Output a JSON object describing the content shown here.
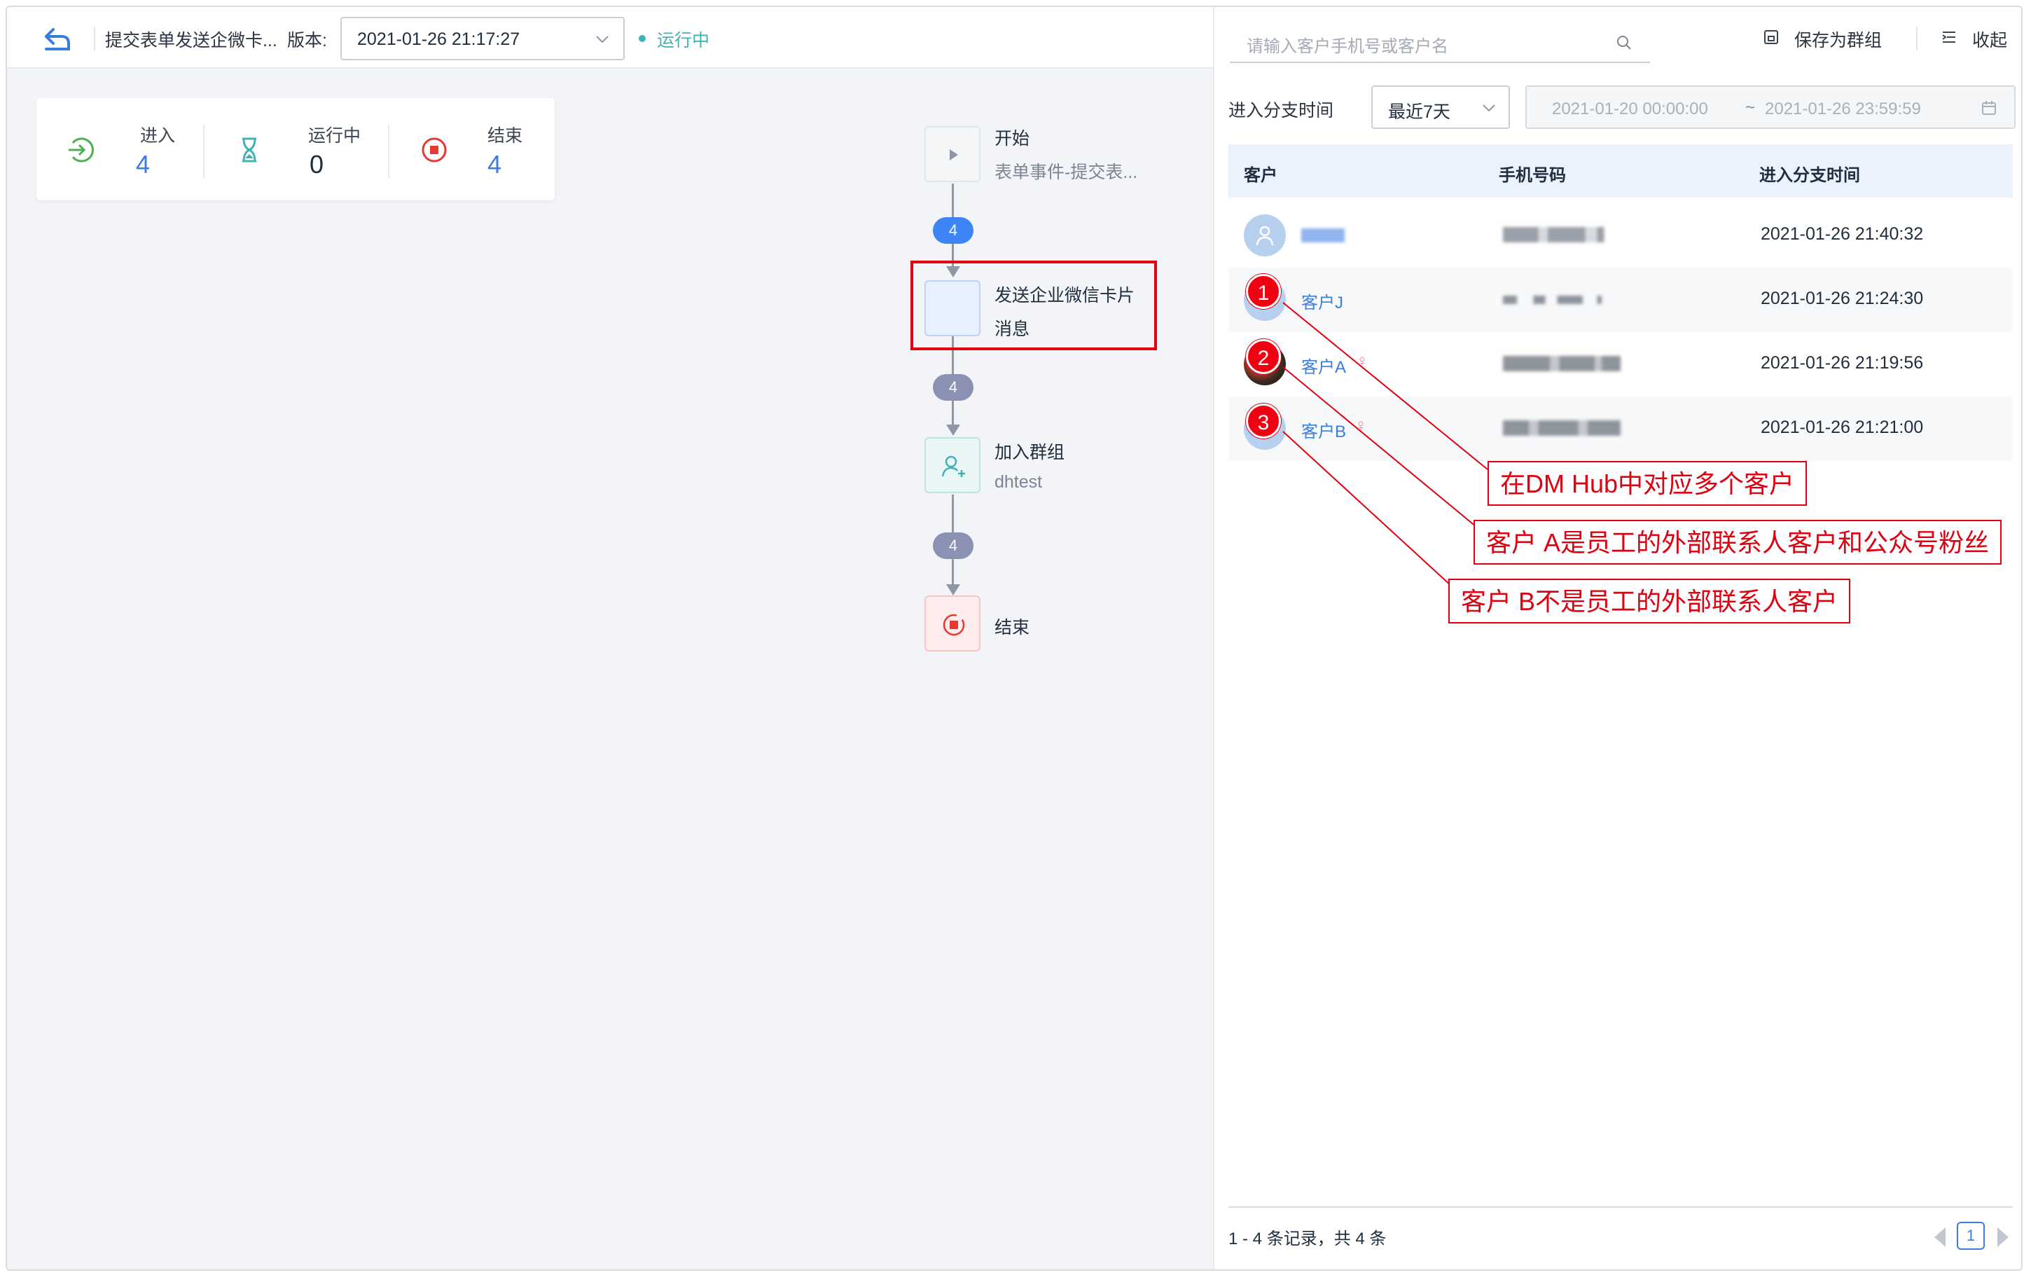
{
  "topbar": {
    "flow_title": "提交表单发送企微卡...",
    "version_label": "版本:",
    "version_value": "2021-01-26 21:17:27",
    "status": "运行中"
  },
  "stats": [
    {
      "label": "进入",
      "value": "4",
      "color": "#4caf50",
      "icon": "enter-icon"
    },
    {
      "label": "运行中",
      "value": "0",
      "color": "#43b2b6",
      "icon": "hourglass-icon"
    },
    {
      "label": "结束",
      "value": "4",
      "color": "#e53935",
      "icon": "stop-icon"
    }
  ],
  "flow": {
    "nodes": [
      {
        "title": "开始",
        "subtitle": "表单事件-提交表...",
        "icon": "play-icon"
      },
      {
        "title_line1": "发送企业微信卡片",
        "title_line2": "消息",
        "icon": "blank-node"
      },
      {
        "title": "加入群组",
        "subtitle": "dhtest",
        "icon": "add-group-icon"
      },
      {
        "title": "结束",
        "icon": "stop-icon"
      }
    ],
    "counts": [
      "4",
      "4",
      "4"
    ],
    "colors": {
      "active_badge": "#3d85f6",
      "badge": "#8b91b3"
    }
  },
  "panel": {
    "search_placeholder": "请输入客户手机号或客户名",
    "save_group": "保存为群组",
    "collapse": "收起",
    "time_label": "进入分支时间",
    "range_value": "最近7天",
    "date_start": "2021-01-20 00:00:00",
    "date_sep": "~",
    "date_end": "2021-01-26 23:59:59",
    "columns": [
      "客户",
      "手机号码",
      "进入分支时间"
    ],
    "rows": [
      {
        "name": "",
        "time": "2021-01-26 21:40:32",
        "gender": ""
      },
      {
        "name": "客户J",
        "time": "2021-01-26 21:24:30",
        "gender": ""
      },
      {
        "name": "客户A",
        "time": "2021-01-26 21:19:56",
        "gender": "♀"
      },
      {
        "name": "客户B",
        "time": "2021-01-26 21:21:00",
        "gender": "♀"
      }
    ],
    "records": "1 - 4 条记录，共 4 条",
    "page": "1",
    "accent": "#3b7ddd"
  },
  "annotations": {
    "badges": [
      "1",
      "2",
      "3"
    ],
    "callouts": [
      "在DM Hub中对应多个客户",
      "客户 A是员工的外部联系人客户和公众号粉丝",
      "客户 B不是员工的外部联系人客户"
    ],
    "color": "#e00010"
  }
}
